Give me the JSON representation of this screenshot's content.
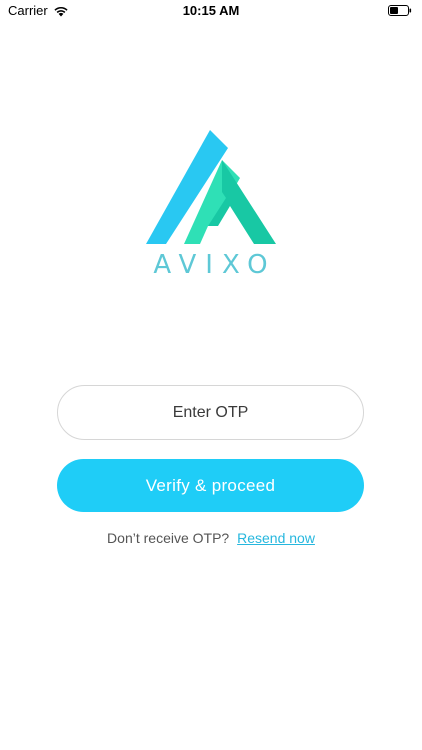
{
  "status_bar": {
    "carrier": "Carrier",
    "time": "10:15 AM",
    "icons": [
      "wifi-icon",
      "battery-icon"
    ]
  },
  "logo": {
    "brand_name": "AVIXO",
    "colors": {
      "primary_blue": "#29c8f2",
      "primary_green": "#2fe0b6",
      "dark_green": "#18c8a4",
      "text": "#5ec8d6"
    }
  },
  "otp": {
    "placeholder": "Enter OTP",
    "value": ""
  },
  "verify": {
    "label": "Verify & proceed",
    "color": "#1fcdf7"
  },
  "resend": {
    "prompt": "Don’t receive OTP?",
    "link_label": "Resend now",
    "link_color": "#26b7de"
  }
}
